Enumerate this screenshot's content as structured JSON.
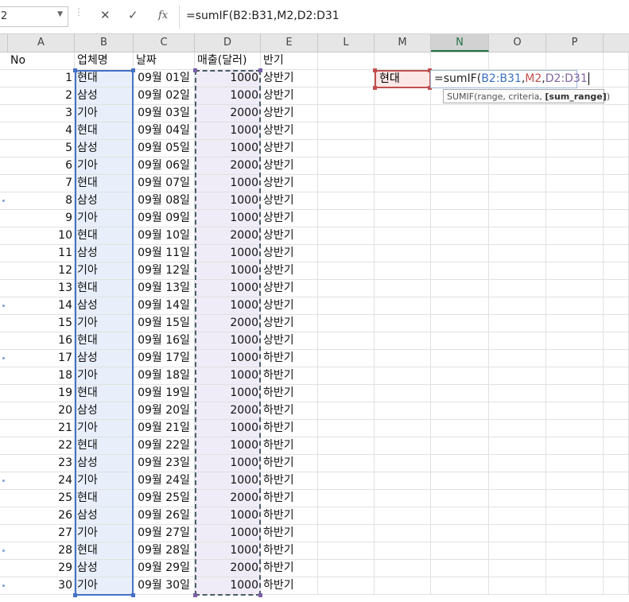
{
  "formula_bar": {
    "name_box": "2",
    "cancel_icon": "✕",
    "enter_icon": "✓",
    "fx_label": "fx",
    "formula": "=sumIF(B2:B31,M2,D2:D31"
  },
  "columns": {
    "A": "A",
    "B": "B",
    "C": "C",
    "D": "D",
    "E": "E",
    "L": "L",
    "M": "M",
    "N": "N",
    "O": "O",
    "P": "P"
  },
  "header_row": {
    "no": "No",
    "company": "업체명",
    "date": "날짜",
    "sales": "매출(달러)",
    "half": "반기"
  },
  "rows": [
    {
      "no": "1",
      "company": "현대",
      "date": "09월 01일",
      "sales": "1000",
      "half": "상반기"
    },
    {
      "no": "2",
      "company": "삼성",
      "date": "09월 02일",
      "sales": "1000",
      "half": "상반기"
    },
    {
      "no": "3",
      "company": "기아",
      "date": "09월 03일",
      "sales": "2000",
      "half": "상반기"
    },
    {
      "no": "4",
      "company": "현대",
      "date": "09월 04일",
      "sales": "1000",
      "half": "상반기"
    },
    {
      "no": "5",
      "company": "삼성",
      "date": "09월 05일",
      "sales": "1000",
      "half": "상반기"
    },
    {
      "no": "6",
      "company": "기아",
      "date": "09월 06일",
      "sales": "2000",
      "half": "상반기"
    },
    {
      "no": "7",
      "company": "현대",
      "date": "09월 07일",
      "sales": "1000",
      "half": "상반기"
    },
    {
      "no": "8",
      "company": "삼성",
      "date": "09월 08일",
      "sales": "1000",
      "half": "상반기"
    },
    {
      "no": "9",
      "company": "기아",
      "date": "09월 09일",
      "sales": "1000",
      "half": "상반기"
    },
    {
      "no": "10",
      "company": "현대",
      "date": "09월 10일",
      "sales": "2000",
      "half": "상반기"
    },
    {
      "no": "11",
      "company": "삼성",
      "date": "09월 11일",
      "sales": "1000",
      "half": "상반기"
    },
    {
      "no": "12",
      "company": "기아",
      "date": "09월 12일",
      "sales": "1000",
      "half": "상반기"
    },
    {
      "no": "13",
      "company": "현대",
      "date": "09월 13일",
      "sales": "1000",
      "half": "상반기"
    },
    {
      "no": "14",
      "company": "삼성",
      "date": "09월 14일",
      "sales": "1000",
      "half": "상반기"
    },
    {
      "no": "15",
      "company": "기아",
      "date": "09월 15일",
      "sales": "2000",
      "half": "상반기"
    },
    {
      "no": "16",
      "company": "현대",
      "date": "09월 16일",
      "sales": "1000",
      "half": "상반기"
    },
    {
      "no": "17",
      "company": "삼성",
      "date": "09월 17일",
      "sales": "1000",
      "half": "하반기"
    },
    {
      "no": "18",
      "company": "기아",
      "date": "09월 18일",
      "sales": "1000",
      "half": "하반기"
    },
    {
      "no": "19",
      "company": "현대",
      "date": "09월 19일",
      "sales": "1000",
      "half": "하반기"
    },
    {
      "no": "20",
      "company": "삼성",
      "date": "09월 20일",
      "sales": "2000",
      "half": "하반기"
    },
    {
      "no": "21",
      "company": "기아",
      "date": "09월 21일",
      "sales": "1000",
      "half": "하반기"
    },
    {
      "no": "22",
      "company": "현대",
      "date": "09월 22일",
      "sales": "1000",
      "half": "하반기"
    },
    {
      "no": "23",
      "company": "삼성",
      "date": "09월 23일",
      "sales": "1000",
      "half": "하반기"
    },
    {
      "no": "24",
      "company": "기아",
      "date": "09월 24일",
      "sales": "1000",
      "half": "하반기"
    },
    {
      "no": "25",
      "company": "현대",
      "date": "09월 25일",
      "sales": "2000",
      "half": "하반기"
    },
    {
      "no": "26",
      "company": "삼성",
      "date": "09월 26일",
      "sales": "1000",
      "half": "하반기"
    },
    {
      "no": "27",
      "company": "기아",
      "date": "09월 27일",
      "sales": "1000",
      "half": "하반기"
    },
    {
      "no": "28",
      "company": "현대",
      "date": "09월 28일",
      "sales": "1000",
      "half": "하반기"
    },
    {
      "no": "29",
      "company": "삼성",
      "date": "09월 29일",
      "sales": "2000",
      "half": "하반기"
    },
    {
      "no": "30",
      "company": "기아",
      "date": "09월 30일",
      "sales": "1000",
      "half": "하반기"
    }
  ],
  "criteria_cell": {
    "value": "현대"
  },
  "edit_cell": {
    "prefix": "=sumIF(",
    "range1": "B2:B31",
    "sep1": ",",
    "criteria": "M2",
    "sep2": ",",
    "range2": "D2:D31"
  },
  "tooltip": {
    "text": "SUMIF(range, criteria, ",
    "bold": "[sum_range]",
    "end": ")"
  },
  "colors": {
    "range1": "#3a6fc4",
    "criteria": "#c0504d",
    "range2": "#8064a2",
    "accent": "#217346"
  }
}
